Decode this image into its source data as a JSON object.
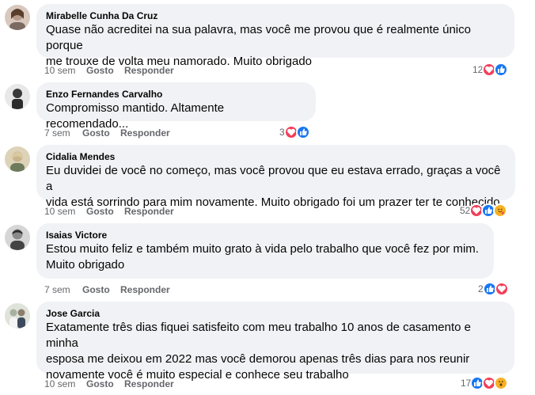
{
  "comments": [
    {
      "author": "Mirabelle Cunha Da Cruz",
      "text": "Quase não acreditei na sua palavra, mas você me provou que é realmente único porque\nme trouxe de volta meu namorado. Muito obrigado",
      "time": "10 sem",
      "like_label": "Gosto",
      "reply_label": "Responder",
      "reaction_count": "12",
      "reactions": [
        "love",
        "like"
      ],
      "avatar_color": "#b89a8a"
    },
    {
      "author": "Enzo Fernandes Carvalho",
      "text": "Compromisso mantido. Altamente recomendado...",
      "time": "7 sem",
      "like_label": "Gosto",
      "reply_label": "Responder",
      "reaction_count": "3",
      "reactions": [
        "love",
        "like"
      ],
      "avatar_color": "#3a3a3a"
    },
    {
      "author": "Cidalia Mendes",
      "text": "Eu duvidei de você no começo, mas você provou que eu estava errado, graças a você a\nvida está sorrindo para mim novamente. Muito obrigado foi um prazer ter te conhecido",
      "time": "10 sem",
      "like_label": "Gosto",
      "reply_label": "Responder",
      "reaction_count": "52",
      "reactions": [
        "love",
        "like",
        "care"
      ],
      "avatar_color": "#c9b48c"
    },
    {
      "author": "Isaias Victore",
      "text": "Estou muito feliz e também muito grato à vida pelo trabalho que você fez por mim.\nMuito obrigado",
      "time": "7 sem",
      "like_label": "Gosto",
      "reply_label": "Responder",
      "reaction_count": "2",
      "reactions": [
        "like",
        "love"
      ],
      "avatar_color": "#8a8a8a"
    },
    {
      "author": "Jose Garcia",
      "text": "Exatamente três dias fiquei satisfeito com meu trabalho 10 anos de casamento e minha\nesposa me deixou em 2022 mas você demorou apenas três dias para nos reunir\nnovamente você é muito especial e conhece seu trabalho",
      "time": "10 sem",
      "like_label": "Gosto",
      "reply_label": "Responder",
      "reaction_count": "17",
      "reactions": [
        "like",
        "love",
        "wow"
      ],
      "avatar_color": "#a8b0a0"
    }
  ],
  "colors": {
    "bubble": "#f0f2f5",
    "meta_text": "#65676b",
    "like_blue": "#1877f2",
    "love_red": "#f33e58",
    "care_yellow": "#f7b125"
  }
}
